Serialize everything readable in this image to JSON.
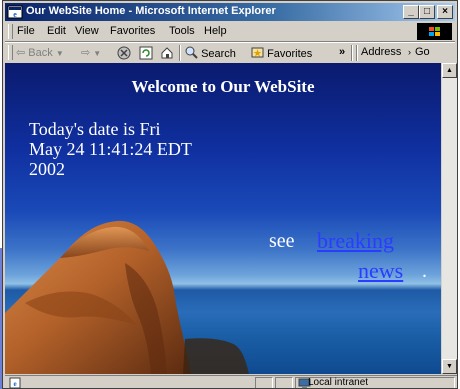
{
  "window": {
    "title": "Our WebSite Home - Microsoft Internet Explorer",
    "controls": {
      "minimize": "_",
      "maximize": "□",
      "close": "×"
    }
  },
  "menu": {
    "items": [
      "File",
      "Edit",
      "View",
      "Favorites",
      "Tools",
      "Help"
    ]
  },
  "toolbar": {
    "back": "Back",
    "search": "Search",
    "favorites": "Favorites",
    "overflow": "»",
    "address": "Address",
    "go": "Go"
  },
  "page": {
    "welcome": "Welcome to Our WebSite",
    "date_line1": "Today's date is  Fri",
    "date_line2": "May 24 11:41:24 EDT",
    "date_line3": "2002",
    "see": "see",
    "link_part1": "breaking",
    "link_part2": "news",
    "link_period": "."
  },
  "status": {
    "zone": "Local intranet"
  },
  "icons": [
    "ie-icon",
    "back-icon",
    "forward-icon",
    "stop-icon",
    "refresh-icon",
    "home-icon",
    "search-icon",
    "favorites-icon",
    "windows-logo-icon",
    "scroll-up-icon",
    "scroll-down-icon",
    "page-icon",
    "intranet-icon"
  ]
}
